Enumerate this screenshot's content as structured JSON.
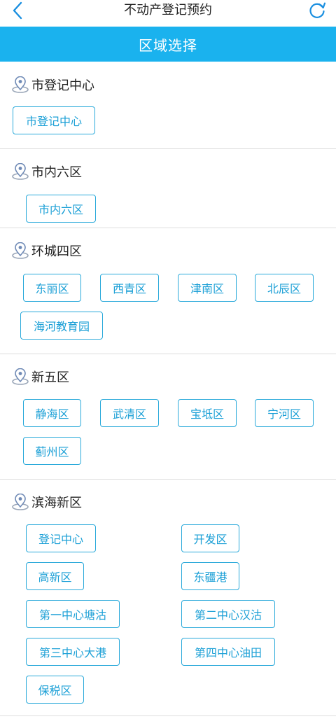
{
  "nav": {
    "title": "不动产登记预约"
  },
  "band": {
    "title": "区域选择"
  },
  "colors": {
    "accent": "#1ab2ee",
    "button_border": "#29a9da",
    "button_text": "#1a9fd6"
  },
  "icons": {
    "back": "chevron-left-icon",
    "refresh": "refresh-icon",
    "section": "location-pin-icon"
  },
  "sections": [
    {
      "title": "市登记中心",
      "buttons": [
        "市登记中心"
      ]
    },
    {
      "title": "市内六区",
      "buttons": [
        "市内六区"
      ]
    },
    {
      "title": "环城四区",
      "buttons": [
        "东丽区",
        "西青区",
        "津南区",
        "北辰区",
        "海河教育园"
      ]
    },
    {
      "title": "新五区",
      "buttons": [
        "静海区",
        "武清区",
        "宝坻区",
        "宁河区",
        "蓟州区"
      ]
    },
    {
      "title": "滨海新区",
      "buttons": [
        "登记中心",
        "开发区",
        "高新区",
        "东疆港",
        "第一中心塘沽",
        "第二中心汉沽",
        "第三中心大港",
        "第四中心油田",
        "保税区"
      ]
    }
  ]
}
